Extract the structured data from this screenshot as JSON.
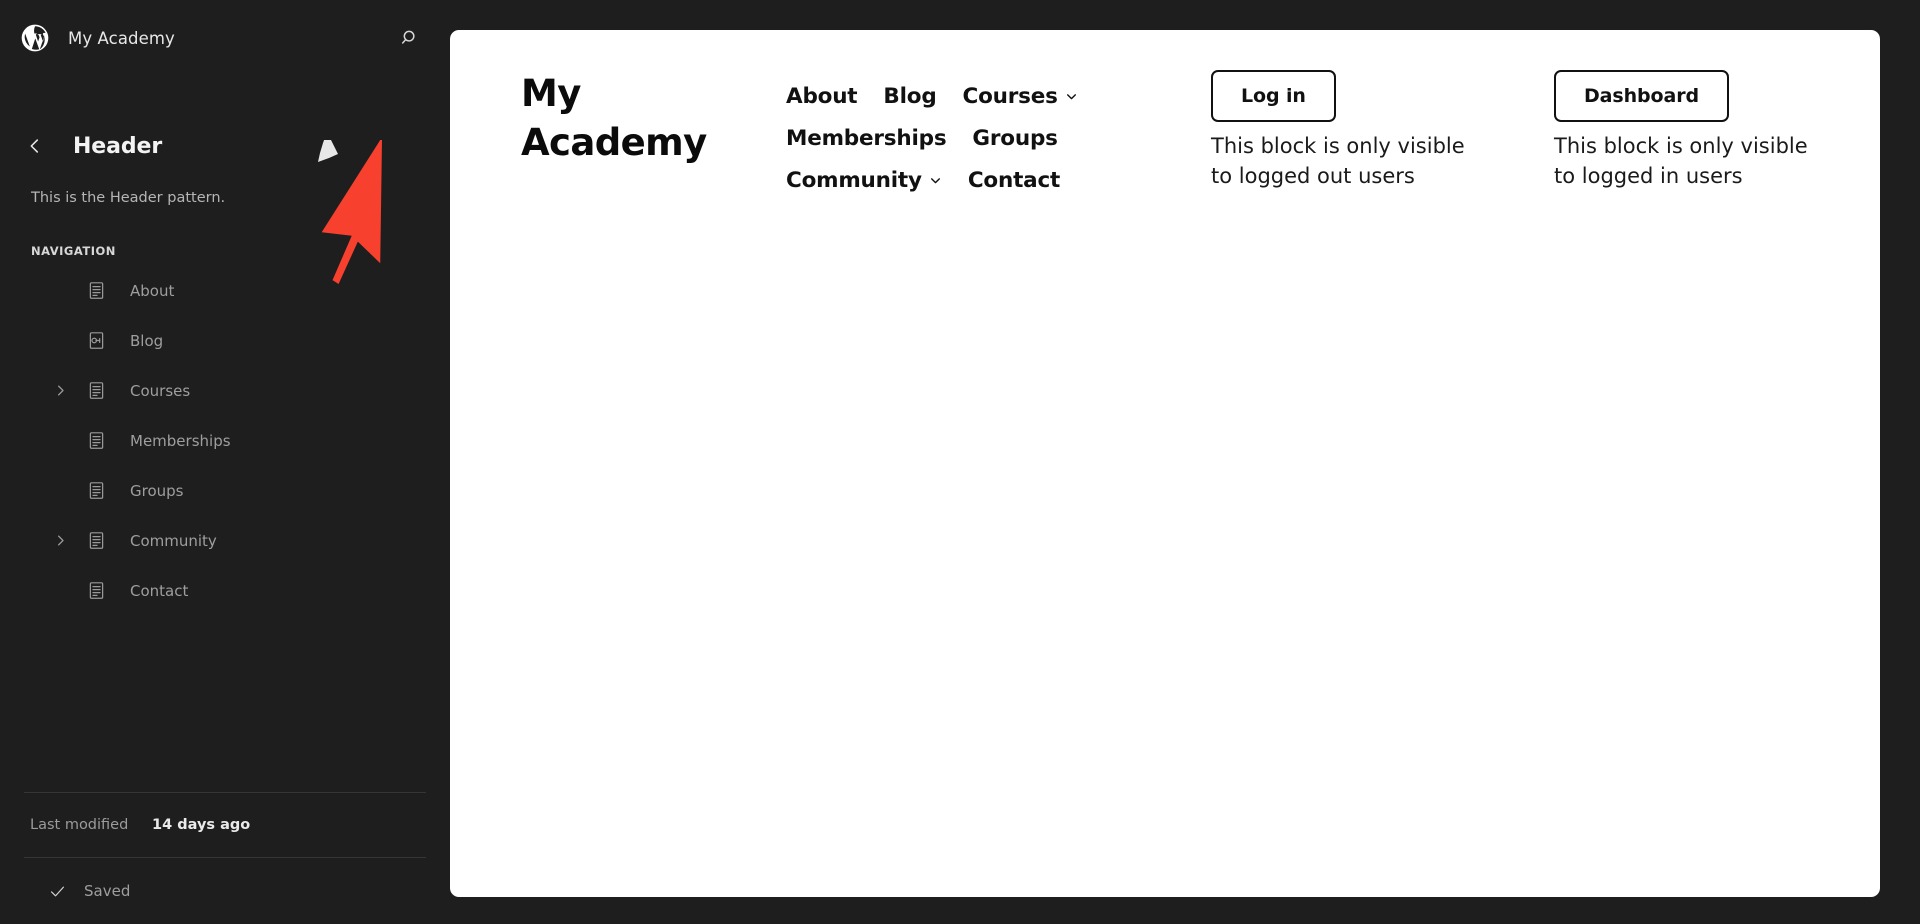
{
  "editor": {
    "site_title": "My Academy",
    "wp_logo_icon": "wordpress-logo-icon",
    "search_icon": "search-icon",
    "back_icon": "chevron-left-icon",
    "panel_title": "Header",
    "panel_description": "This is the Header pattern.",
    "section_label": "NAVIGATION",
    "nav_items": [
      {
        "label": "About",
        "icon": "page-icon",
        "expandable": false
      },
      {
        "label": "Blog",
        "icon": "link-icon",
        "expandable": false
      },
      {
        "label": "Courses",
        "icon": "page-icon",
        "expandable": true
      },
      {
        "label": "Memberships",
        "icon": "page-icon",
        "expandable": false
      },
      {
        "label": "Groups",
        "icon": "page-icon",
        "expandable": false
      },
      {
        "label": "Community",
        "icon": "page-icon",
        "expandable": true
      },
      {
        "label": "Contact",
        "icon": "page-icon",
        "expandable": false
      }
    ],
    "footer": {
      "last_modified_label": "Last modified",
      "last_modified_value": "14 days ago",
      "saved_label": "Saved",
      "saved_icon": "check-icon"
    }
  },
  "canvas": {
    "brand_line1": "My",
    "brand_line2": "Academy",
    "nav_links": [
      {
        "label": "About",
        "has_submenu": false
      },
      {
        "label": "Blog",
        "has_submenu": false
      },
      {
        "label": "Courses",
        "has_submenu": true
      },
      {
        "label": "Memberships",
        "has_submenu": false
      },
      {
        "label": "Groups",
        "has_submenu": false
      },
      {
        "label": "Community",
        "has_submenu": true
      },
      {
        "label": "Contact",
        "has_submenu": false
      }
    ],
    "logged_out_block": {
      "button_label": "Log in",
      "note": "This block is only visible to logged out users"
    },
    "logged_in_block": {
      "button_label": "Dashboard",
      "note": "This block is only visible to logged in users"
    }
  },
  "annotation": {
    "arrow_icon": "red-arrow-pointer-icon",
    "arrow_color": "#f8402f"
  },
  "colors": {
    "sidebar_bg": "#1e1e1e",
    "canvas_bg": "#ffffff",
    "text_primary": "#f3f3f3",
    "text_muted": "#9e9e9e",
    "canvas_text": "#111111",
    "accent_red": "#f8402f"
  }
}
